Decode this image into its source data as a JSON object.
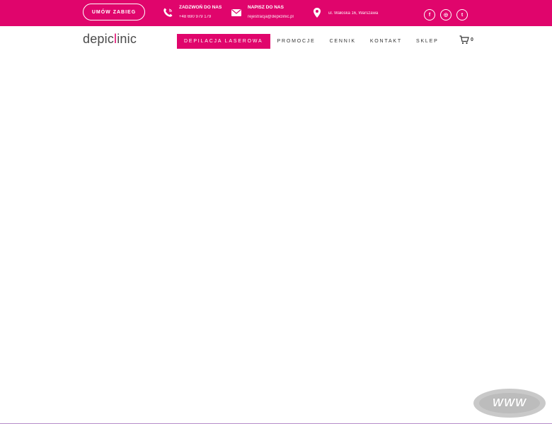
{
  "topbar": {
    "cta_label": "UMÓW ZABIEG",
    "phone": {
      "title": "ZADZWOŃ DO NAS",
      "value": "+48 690 979 179"
    },
    "email": {
      "title": "NAPISZ DO NAS",
      "value": "rejestracja@depiclinic.pl"
    },
    "address": {
      "value": "ul. Wałoska 16, Warszawa"
    },
    "social": {
      "facebook": "f",
      "instagram": "◎",
      "twitter": "t"
    }
  },
  "header": {
    "logo_prefix": "depic",
    "logo_accent": "l",
    "logo_suffix": "inic",
    "nav": [
      {
        "label": "DEPILACJA LASEROWA"
      },
      {
        "label": "PROMOCJE"
      },
      {
        "label": "CENNIK"
      },
      {
        "label": "KONTAKT"
      },
      {
        "label": "SKLEP"
      }
    ],
    "cart_count": "0"
  },
  "badge": {
    "label": "WWW"
  },
  "colors": {
    "brand": "#e0056c",
    "text": "#333333"
  },
  "icons": [
    "phone-icon",
    "envelope-icon",
    "map-pin-icon",
    "facebook-icon",
    "instagram-icon",
    "twitter-icon",
    "cart-icon"
  ]
}
